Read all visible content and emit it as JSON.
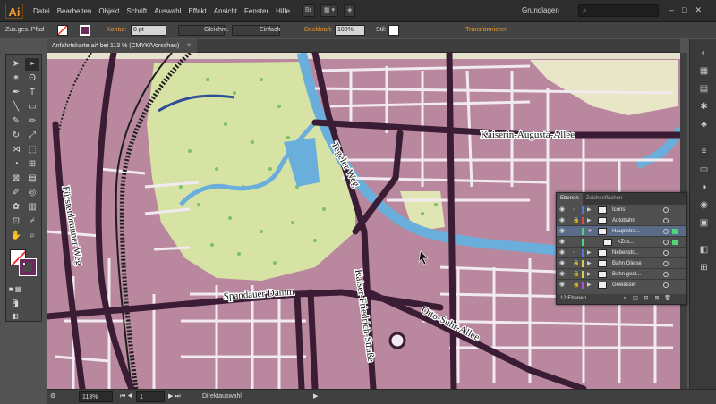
{
  "app": {
    "logo": "Ai",
    "menu": [
      "Datei",
      "Bearbeiten",
      "Objekt",
      "Schrift",
      "Auswahl",
      "Effekt",
      "Ansicht",
      "Fenster",
      "Hilfe"
    ],
    "br_label": "Br",
    "workspace": "Grundlagen",
    "search_placeholder": ""
  },
  "controlbar": {
    "selection": "Zus.ges. Pfad",
    "stroke_label": "Kontur:",
    "stroke_weight": "8 pt",
    "profile": "Gleichm.",
    "brush": "Einfach",
    "opacity_label": "Deckkraft:",
    "opacity_value": "100%",
    "style_label": "Stil:",
    "transform_label": "Transformieren"
  },
  "document": {
    "tab_title": "Anfahrtskarte.ai* bei 113 % (CMYK/Vorschau)",
    "zoom": "113%",
    "artboard": "1",
    "status_tool": "Direktauswahl"
  },
  "map": {
    "streets": [
      "Kaiserin-Augusta-Allee",
      "Tegeler Weg",
      "Fürstenbrunner Weg",
      "Spandauer Damm",
      "Kaiser-Friedrich-Straße",
      "Otto-Suhr-Allee"
    ],
    "colors": {
      "residential": "#b9889e",
      "park": "#d7e3a4",
      "water": "#6aaedb",
      "main_road": "#3a1d34",
      "minor_road": "#f1eaf1"
    }
  },
  "layers_panel": {
    "tabs": [
      "Ebenen",
      "Zeichenflächen"
    ],
    "rows": [
      {
        "name": "Icons",
        "color": "#4f7dd6",
        "expanded": false,
        "selected": false
      },
      {
        "name": "Autobahn",
        "color": "#d64f4f",
        "expanded": false,
        "selected": false
      },
      {
        "name": "Hauptstra...",
        "color": "#4fd67d",
        "expanded": true,
        "selected": true
      },
      {
        "name": "<Zus...",
        "color": "#4fd67d",
        "expanded": false,
        "selected": false,
        "sublayer": true
      },
      {
        "name": "Nebenstr...",
        "color": "#4f7dd6",
        "expanded": false,
        "selected": false
      },
      {
        "name": "Bahn Gleise",
        "color": "#d6d14f",
        "expanded": false,
        "selected": false
      },
      {
        "name": "Bahn gest...",
        "color": "#d6d14f",
        "expanded": false,
        "selected": false
      },
      {
        "name": "Gewässer",
        "color": "#b04fd6",
        "expanded": false,
        "selected": false
      }
    ],
    "footer": "12 Ebenen"
  }
}
